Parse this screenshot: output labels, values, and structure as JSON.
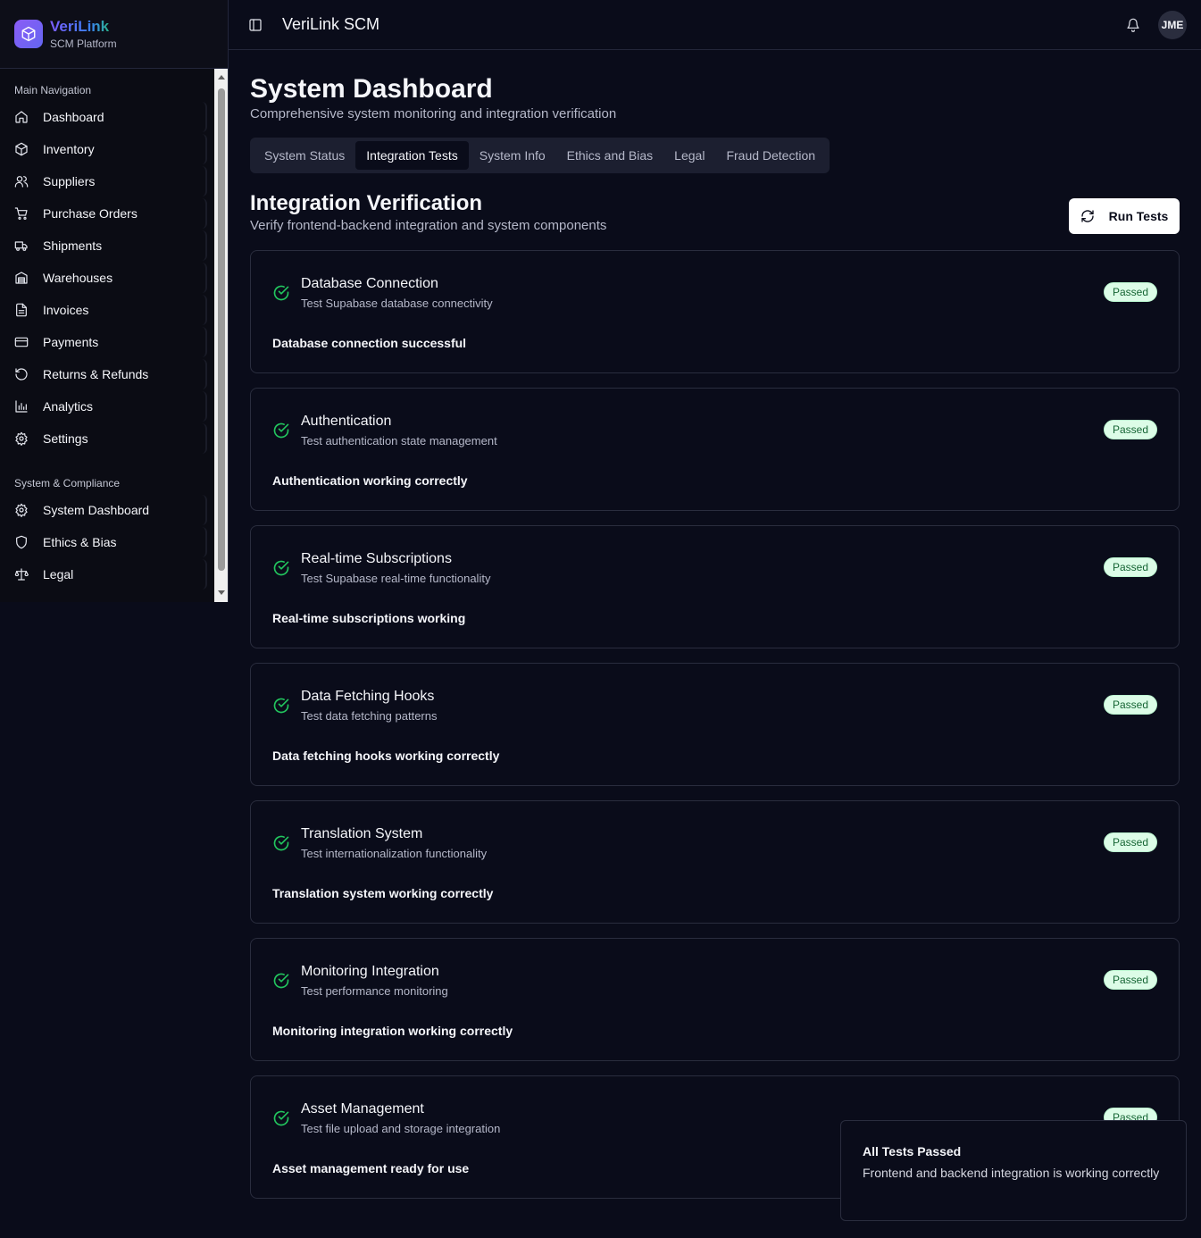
{
  "brand": {
    "name": "VeriLink",
    "subtitle": "SCM Platform"
  },
  "sidebar": {
    "sections": [
      {
        "label": "Main Navigation",
        "items": [
          {
            "label": "Dashboard",
            "icon": "home-icon"
          },
          {
            "label": "Inventory",
            "icon": "package-icon"
          },
          {
            "label": "Suppliers",
            "icon": "users-icon"
          },
          {
            "label": "Purchase Orders",
            "icon": "cart-icon"
          },
          {
            "label": "Shipments",
            "icon": "truck-icon"
          },
          {
            "label": "Warehouses",
            "icon": "warehouse-icon"
          },
          {
            "label": "Invoices",
            "icon": "file-icon"
          },
          {
            "label": "Payments",
            "icon": "credit-card-icon"
          },
          {
            "label": "Returns & Refunds",
            "icon": "rotate-icon"
          },
          {
            "label": "Analytics",
            "icon": "bar-chart-icon"
          },
          {
            "label": "Settings",
            "icon": "gear-icon"
          }
        ]
      },
      {
        "label": "System & Compliance",
        "items": [
          {
            "label": "System Dashboard",
            "icon": "gear-icon"
          },
          {
            "label": "Ethics & Bias",
            "icon": "shield-icon"
          },
          {
            "label": "Legal",
            "icon": "scale-icon"
          }
        ]
      }
    ]
  },
  "header": {
    "title": "VeriLink SCM",
    "avatar_initials": "JME"
  },
  "page": {
    "title": "System Dashboard",
    "subtitle": "Comprehensive system monitoring and integration verification",
    "tabs": [
      "System Status",
      "Integration Tests",
      "System Info",
      "Ethics and Bias",
      "Legal",
      "Fraud Detection"
    ],
    "active_tab": "Integration Tests"
  },
  "section": {
    "title": "Integration Verification",
    "subtitle": "Verify frontend-backend integration and system components",
    "run_button": "Run Tests"
  },
  "tests": [
    {
      "title": "Database Connection",
      "desc": "Test Supabase database connectivity",
      "status": "Passed",
      "result": "Database connection successful"
    },
    {
      "title": "Authentication",
      "desc": "Test authentication state management",
      "status": "Passed",
      "result": "Authentication working correctly"
    },
    {
      "title": "Real-time Subscriptions",
      "desc": "Test Supabase real-time functionality",
      "status": "Passed",
      "result": "Real-time subscriptions working"
    },
    {
      "title": "Data Fetching Hooks",
      "desc": "Test data fetching patterns",
      "status": "Passed",
      "result": "Data fetching hooks working correctly"
    },
    {
      "title": "Translation System",
      "desc": "Test internationalization functionality",
      "status": "Passed",
      "result": "Translation system working correctly"
    },
    {
      "title": "Monitoring Integration",
      "desc": "Test performance monitoring",
      "status": "Passed",
      "result": "Monitoring integration working correctly"
    },
    {
      "title": "Asset Management",
      "desc": "Test file upload and storage integration",
      "status": "Passed",
      "result": "Asset management ready for use"
    }
  ],
  "toast": {
    "title": "All Tests Passed",
    "body": "Frontend and backend integration is working correctly"
  },
  "colors": {
    "accent": "#8b5cf6",
    "success": "#22c55e",
    "badge_bg": "#dcfce7",
    "background": "#0a0c1a"
  }
}
